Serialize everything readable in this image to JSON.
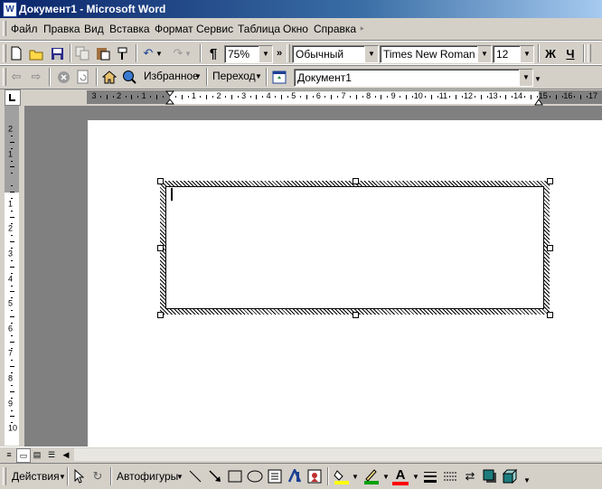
{
  "window": {
    "title": "Документ1 - Microsoft Word",
    "app_icon": "W"
  },
  "menu": [
    "Файл",
    "Правка",
    "Вид",
    "Вставка",
    "Формат",
    "Сервис",
    "Таблица",
    "Окно",
    "Справка"
  ],
  "menu_help_mark": "‣",
  "standard_toolbar": {
    "zoom": "75%",
    "paragraph_mark": "¶",
    "style": "Обычный",
    "font": "Times New Roman",
    "size": "12",
    "bold_label": "Ж",
    "underline_label": "Ч"
  },
  "web_toolbar": {
    "favorites_label": "Избранное",
    "go_label": "Переход",
    "address": "Документ1"
  },
  "hruler_ticks": [
    "3",
    "2",
    "1",
    "",
    "1",
    "2",
    "3",
    "4",
    "5",
    "6",
    "7",
    "8",
    "9",
    "10",
    "11",
    "12",
    "13",
    "14",
    "15",
    "16",
    "17"
  ],
  "vruler_ticks": [
    "2",
    "1",
    "",
    "1",
    "2",
    "3",
    "4",
    "5",
    "6",
    "7",
    "8",
    "9",
    "10"
  ],
  "drawing_toolbar": {
    "actions_label": "Действия",
    "autoshapes_label": "Автофигуры",
    "font_color_label": "A",
    "fill_color": "#ffff00",
    "line_color": "#00a000",
    "font_color": "#ff0000"
  },
  "icons": {
    "new": "new-document-icon",
    "open": "open-folder-icon",
    "save": "save-icon",
    "copy": "copy-icon",
    "paste": "paste-icon",
    "format_painter": "format-painter-icon",
    "undo": "undo-icon",
    "redo": "redo-icon",
    "back": "back-arrow-icon",
    "forward": "forward-arrow-icon",
    "stop": "stop-icon",
    "refresh": "refresh-icon",
    "home": "home-icon",
    "search_web": "search-web-icon"
  }
}
